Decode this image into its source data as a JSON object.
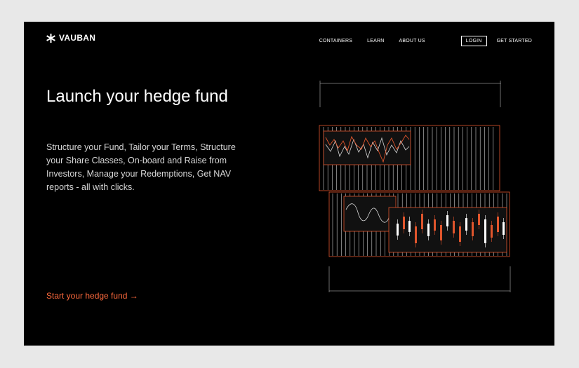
{
  "brand": {
    "name": "VAUBAN",
    "logo_icon": "asterisk-icon"
  },
  "nav": {
    "items": [
      "CONTAINERS",
      "LEARN",
      "ABOUT US"
    ],
    "login": "LOGIN",
    "get_started": "GET STARTED"
  },
  "hero": {
    "title": "Launch your hedge fund",
    "description": "Structure your Fund, Tailor your Terms, Structure your Share Classes, On-board and Raise from Investors, Manage your Redemptions, Get NAV reports - all with clicks.",
    "cta": "Start your hedge fund →"
  },
  "colors": {
    "accent": "#ff6a3d",
    "background": "#000000",
    "line": "#8a8a8a"
  }
}
